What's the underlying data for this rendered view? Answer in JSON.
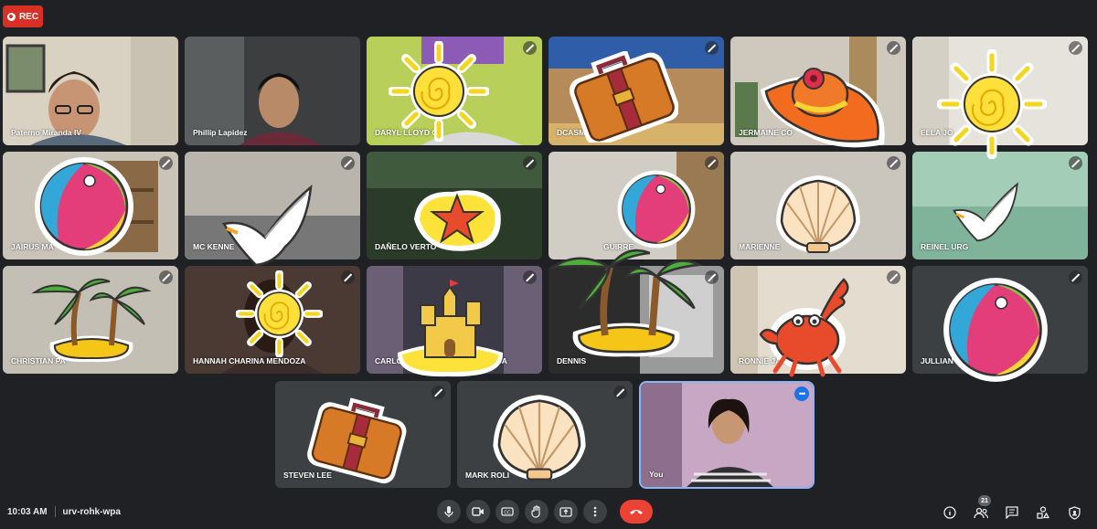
{
  "recording": {
    "label": "REC",
    "color": "#d93025"
  },
  "participants": [
    {
      "name": "Paterno Miranda IV",
      "muted": false
    },
    {
      "name": "Phillip Lapidez",
      "muted": false
    },
    {
      "name": "DARYL LLOYD C",
      "muted": true
    },
    {
      "name": "DCASMEI",
      "muted": true
    },
    {
      "name": "JERMAINE CO",
      "muted": true
    },
    {
      "name": "ELLA JO",
      "muted": true
    },
    {
      "name": "JAIRUS MA",
      "muted": true
    },
    {
      "name": "MC KENNE",
      "muted": true
    },
    {
      "name": "DAÑELO VERTO",
      "muted": true
    },
    {
      "name": "GUIRRE",
      "muted": true
    },
    {
      "name": "MARIENNE",
      "muted": true
    },
    {
      "name": "REINEL URG",
      "muted": true
    },
    {
      "name": "CHRISTIAN PA",
      "muted": true
    },
    {
      "name": "HANNAH CHARINA MENDOZA",
      "muted": true
    },
    {
      "name": "CARLOS A",
      "name_suffix": "GA",
      "muted": true
    },
    {
      "name": "DENNIS",
      "muted": true
    },
    {
      "name": "RONNIE JAME",
      "muted": true
    },
    {
      "name": "JULLIAN",
      "muted": true
    },
    {
      "name": "STEVEN LEE",
      "muted": true
    },
    {
      "name": "MARK ROLI",
      "muted": true
    },
    {
      "name": "You",
      "muted": false
    }
  ],
  "self_tile": {
    "more_icon": "more-options-icon",
    "accent": "#1a73e8"
  },
  "meeting": {
    "time": "10:03 AM",
    "code": "urv-rohk-wpa"
  },
  "controls": [
    {
      "name": "microphone",
      "icon": "mic-icon"
    },
    {
      "name": "camera",
      "icon": "camera-icon"
    },
    {
      "name": "captions",
      "icon": "captions-icon"
    },
    {
      "name": "raise-hand",
      "icon": "hand-icon"
    },
    {
      "name": "present",
      "icon": "present-icon"
    },
    {
      "name": "more-options",
      "icon": "more-vert-icon"
    },
    {
      "name": "end-call",
      "icon": "phone-end-icon",
      "color": "#ea4335"
    }
  ],
  "right_panel": {
    "people_count": "21",
    "icons": [
      "info-icon",
      "people-icon",
      "chat-icon",
      "activities-icon",
      "host-controls-icon"
    ]
  }
}
